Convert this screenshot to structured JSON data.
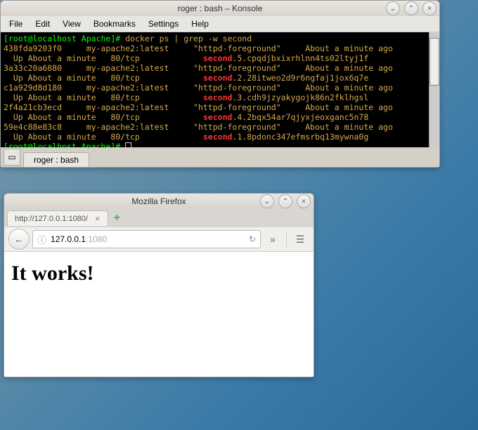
{
  "konsole": {
    "title": "roger : bash – Konsole",
    "menu": [
      "File",
      "Edit",
      "View",
      "Bookmarks",
      "Settings",
      "Help"
    ],
    "tab": "roger : bash",
    "prompt": {
      "user": "root@localhost",
      "path": "Apache",
      "symbol": "#"
    },
    "command": "docker ps | grep -w second",
    "rows": [
      {
        "id": "438fda9203f0",
        "image": "my-apache2:latest",
        "cmd": "\"httpd-foreground\"",
        "created": "About a minute ago",
        "status": "Up About a minute",
        "ports": "80/tcp",
        "hi": "second",
        "name_rest": ".5.cpqdjbxixrhlnn4ts02ltyj1f"
      },
      {
        "id": "3a33c20a6880",
        "image": "my-apache2:latest",
        "cmd": "\"httpd-foreground\"",
        "created": "About a minute ago",
        "status": "Up About a minute",
        "ports": "80/tcp",
        "hi": "second",
        "name_rest": ".2.28itweo2d9r6ngfaj1jox6q7e"
      },
      {
        "id": "c1a929d8d180",
        "image": "my-apache2:latest",
        "cmd": "\"httpd-foreground\"",
        "created": "About a minute ago",
        "status": "Up About a minute",
        "ports": "80/tcp",
        "hi": "second",
        "name_rest": ".3.cdh9jzyakygojk86n2fklhgsl"
      },
      {
        "id": "2f4a21cb3ecd",
        "image": "my-apache2:latest",
        "cmd": "\"httpd-foreground\"",
        "created": "About a minute ago",
        "status": "Up About a minute",
        "ports": "80/tcp",
        "hi": "second",
        "name_rest": ".4.2bqx54ar7qjyxjeoxganc5n78"
      },
      {
        "id": "59e4c88e83c8",
        "image": "my-apache2:latest",
        "cmd": "\"httpd-foreground\"",
        "created": "About a minute ago",
        "status": "Up About a minute",
        "ports": "80/tcp",
        "hi": "second",
        "name_rest": ".1.8pdonc347efmsrbq13mywna0g"
      }
    ]
  },
  "firefox": {
    "title": "Mozilla Firefox",
    "tab_label": "http://127.0.0.1:1080/",
    "url_host": "127.0.0.1",
    "url_port": ":1080",
    "heading": "It works!"
  }
}
